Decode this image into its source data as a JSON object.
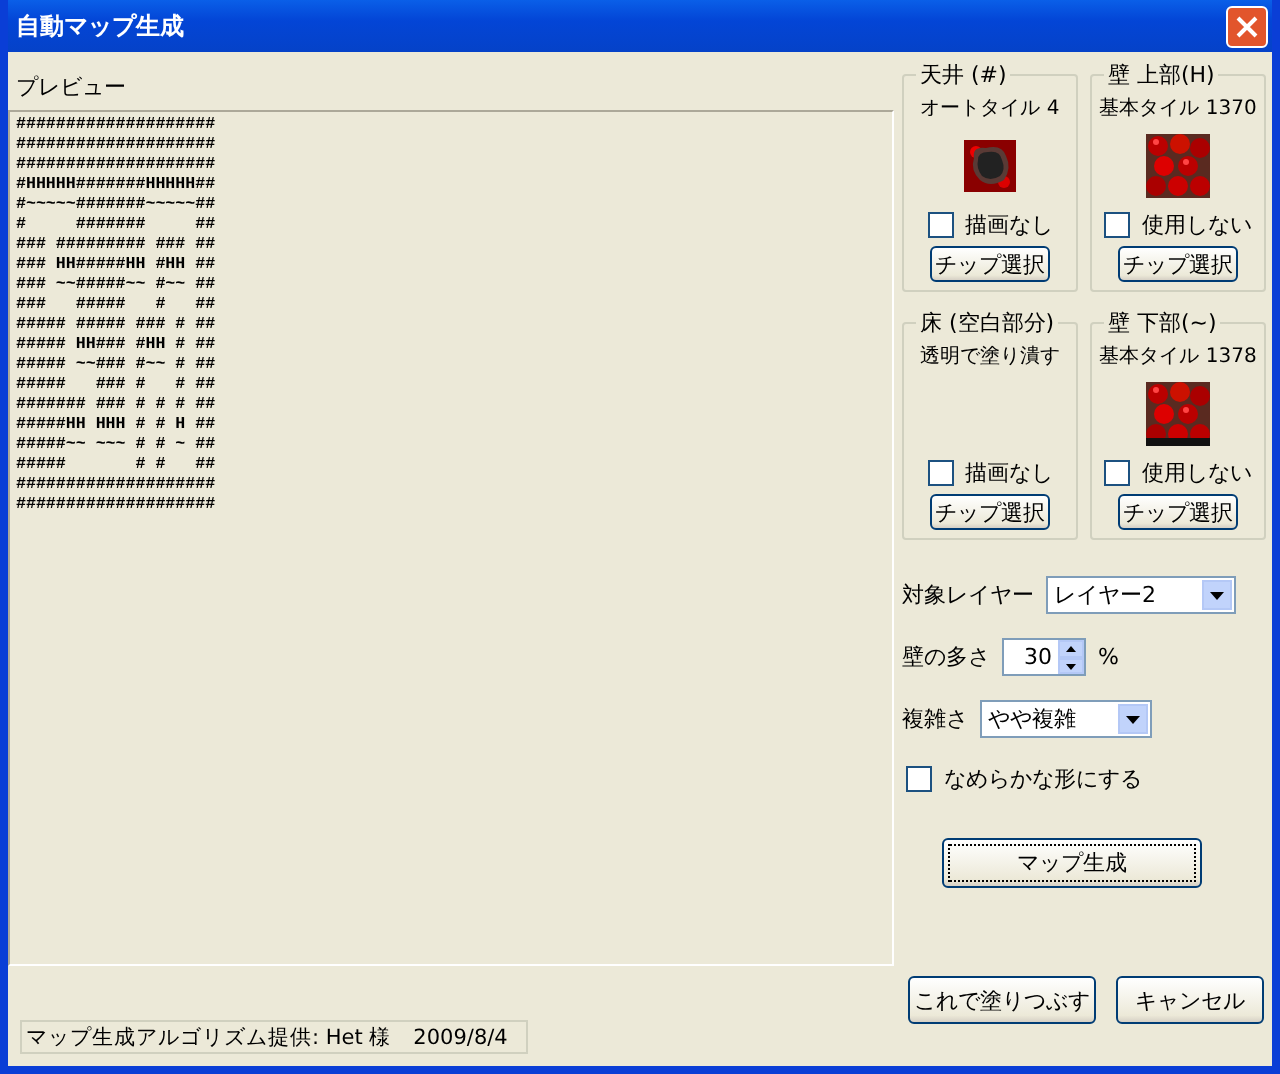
{
  "window": {
    "title": "自動マップ生成"
  },
  "preview": {
    "label": "プレビュー",
    "lines": [
      "####################",
      "####################",
      "####################",
      "#HHHHH#######HHHHH##",
      "#~~~~~#######~~~~~##",
      "#     #######     ##",
      "### ######### ### ##",
      "### HH#####HH #HH ##",
      "### ~~#####~~ #~~ ##",
      "###   #####   #   ##",
      "##### ##### ### # ##",
      "##### HH### #HH # ##",
      "##### ~~### #~~ # ##",
      "#####   ### #   # ##",
      "####### ### # # # ##",
      "#####HH HHH # # H ##",
      "#####~~ ~~~ # # ~ ##",
      "#####       # #   ##",
      "####################",
      "####################"
    ]
  },
  "tiles": [
    {
      "title": "天井 (#)",
      "description": "オートタイル 4",
      "kind": "autotile",
      "checkbox": {
        "label": "描画なし",
        "checked": false
      },
      "button": "チップ選択"
    },
    {
      "title": "壁 上部(H)",
      "description": "基本タイル 1370",
      "kind": "wall",
      "checkbox": {
        "label": "使用しない",
        "checked": false
      },
      "button": "チップ選択"
    },
    {
      "title": "床 (空白部分)",
      "description": "透明で塗り潰す",
      "kind": "none",
      "checkbox": {
        "label": "描画なし",
        "checked": false
      },
      "button": "チップ選択"
    },
    {
      "title": "壁 下部(~)",
      "description": "基本タイル 1378",
      "kind": "wall_bottom",
      "checkbox": {
        "label": "使用しない",
        "checked": false
      },
      "button": "チップ選択"
    }
  ],
  "target_layer": {
    "label": "対象レイヤー",
    "value": "レイヤー2"
  },
  "wall_amount": {
    "label": "壁の多さ",
    "value": "30",
    "unit": "%"
  },
  "complexity": {
    "label": "複雑さ",
    "value": "やや複雑"
  },
  "smooth": {
    "label": "なめらかな形にする",
    "checked": false
  },
  "generate_button": "マップ生成",
  "fill_button": "これで塗りつぶす",
  "cancel_button": "キャンセル",
  "credit": "マップ生成アルゴリズム提供: Het 様　2009/8/4"
}
